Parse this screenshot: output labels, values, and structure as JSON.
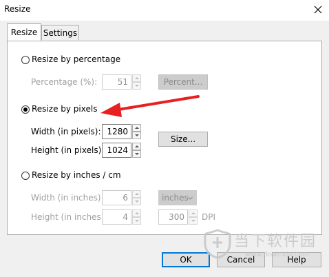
{
  "window": {
    "title": "Resize"
  },
  "tabs": [
    {
      "label": "Resize"
    },
    {
      "label": "Settings"
    }
  ],
  "percentage": {
    "radio_label": "Resize by percentage",
    "field_label": "Percentage (%):",
    "value": "51",
    "button_label": "Percent..."
  },
  "pixels": {
    "radio_label": "Resize by pixels",
    "width_label": "Width (in pixels):",
    "width_value": "1280",
    "height_label": "Height (in pixels):",
    "height_value": "1024",
    "button_label": "Size..."
  },
  "inches": {
    "radio_label": "Resize by inches / cm",
    "width_label": "Width (in inches):",
    "width_value": "6",
    "height_label": "Height (in inches):",
    "height_value": "4",
    "unit_selected": "inches",
    "dpi_value": "300",
    "dpi_label": "DPI"
  },
  "buttons": {
    "ok": "OK",
    "cancel": "Cancel",
    "help": "Help"
  },
  "watermark": {
    "text": "当下软件园",
    "url": "www.downxia.com"
  },
  "annotation": {
    "arrow_color": "#e8201f"
  }
}
